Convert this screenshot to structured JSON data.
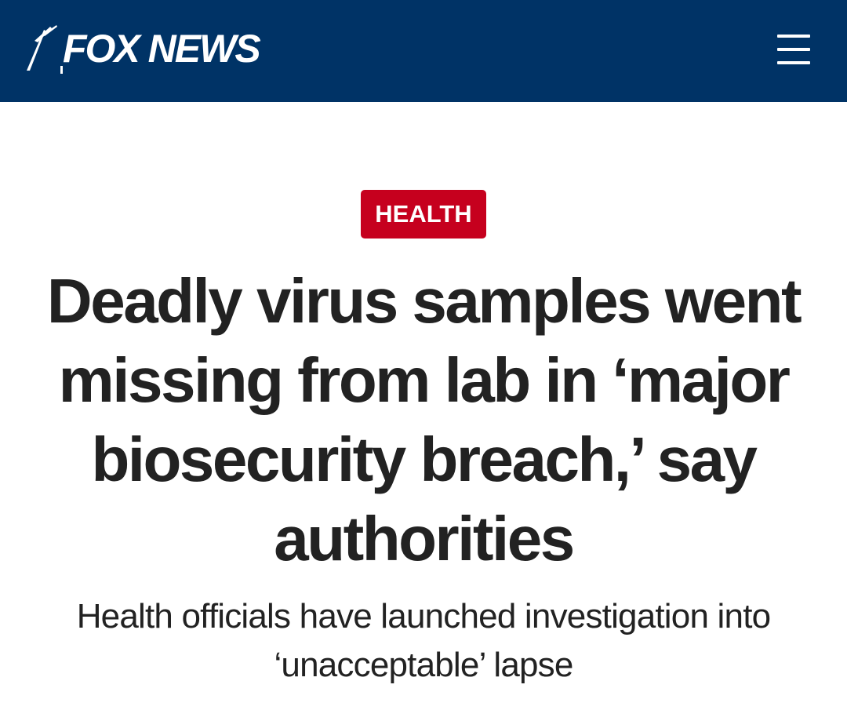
{
  "header": {
    "brand": "FOX NEWS",
    "background_color": "#003366",
    "logo_icon": "fox-news-searchlight-logo",
    "menu_icon": "hamburger-menu-icon"
  },
  "article": {
    "category": "HEALTH",
    "category_color": "#c6001e",
    "headline": "Deadly virus samples went missing from lab in ‘major biosecurity breach,’ say authorities",
    "subheadline": "Health officials have launched investigation into ‘unacceptable’ lapse"
  }
}
